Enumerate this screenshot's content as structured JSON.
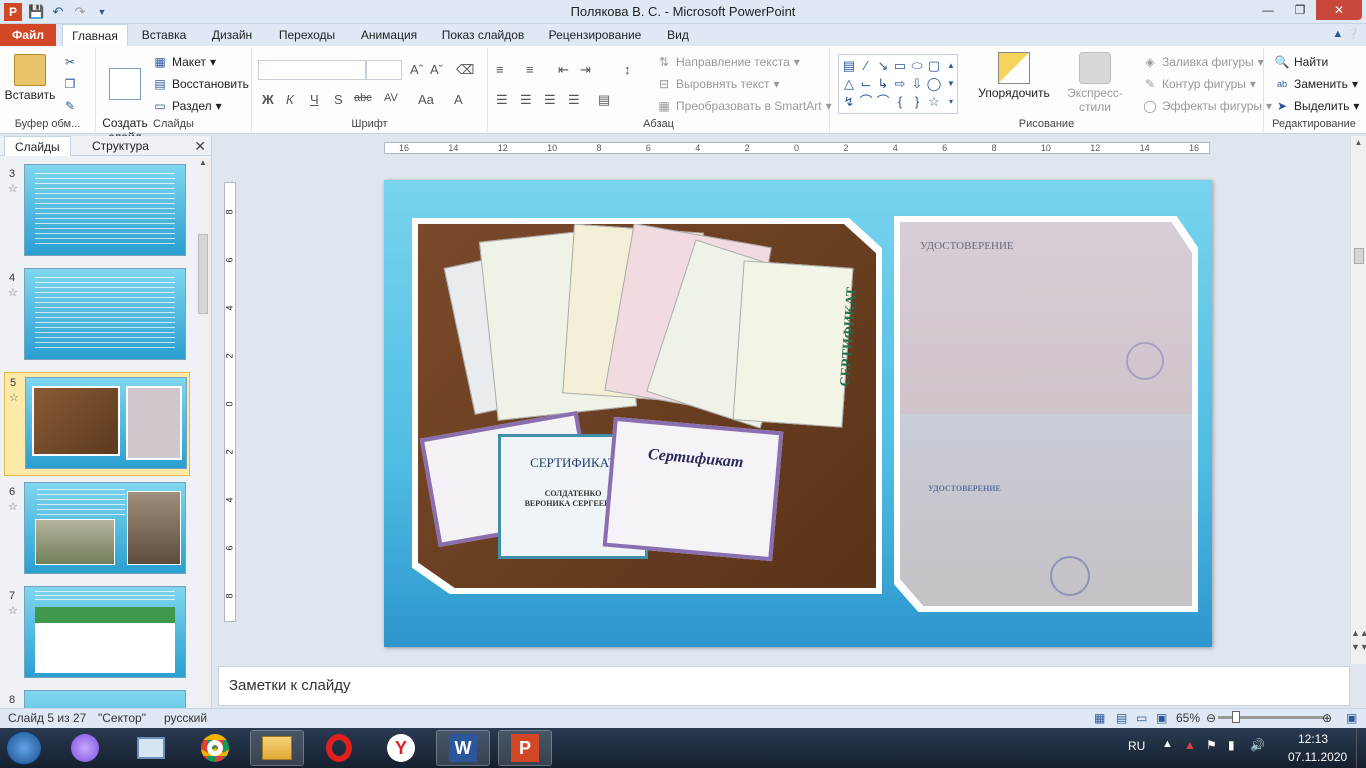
{
  "window": {
    "title": "Полякова В. С.  -  Microsoft PowerPoint",
    "logo": "P"
  },
  "ribbon_tabs": [
    "Файл",
    "Главная",
    "Вставка",
    "Дизайн",
    "Переходы",
    "Анимация",
    "Показ слайдов",
    "Рецензирование",
    "Вид"
  ],
  "ribbon": {
    "clipboard": {
      "paste": "Вставить",
      "label": "Буфер обм..."
    },
    "slides": {
      "new_slide": "Создать\nслайд",
      "layout": "Макет",
      "reset": "Восстановить",
      "section": "Раздел",
      "label": "Слайды"
    },
    "font": {
      "label": "Шрифт",
      "bold": "Ж",
      "italic": "К",
      "underline": "Ч",
      "shadow": "S",
      "strike": "abc",
      "spacing": "AV",
      "case": "Aa",
      "color": "A"
    },
    "paragraph": {
      "text_direction": "Направление текста",
      "align_text": "Выровнять текст",
      "smartart": "Преобразовать в SmartArt",
      "label": "Абзац"
    },
    "drawing": {
      "arrange": "Упорядочить",
      "quick_styles": "Экспресс-стили",
      "fill": "Заливка фигуры",
      "outline": "Контур фигуры",
      "effects": "Эффекты фигуры",
      "label": "Рисование"
    },
    "editing": {
      "find": "Найти",
      "replace": "Заменить",
      "select": "Выделить",
      "label": "Редактирование"
    }
  },
  "panel": {
    "tabs": [
      "Слайды",
      "Структура"
    ],
    "slide_numbers": [
      "3",
      "4",
      "5",
      "6",
      "7",
      "8"
    ],
    "selected": "5"
  },
  "ruler": {
    "h_ticks": [
      "16",
      "14",
      "12",
      "10",
      "8",
      "6",
      "4",
      "2",
      "0",
      "2",
      "4",
      "6",
      "8",
      "10",
      "12",
      "14",
      "16"
    ],
    "v_ticks": [
      "8",
      "6",
      "4",
      "2",
      "0",
      "2",
      "4",
      "6",
      "8"
    ]
  },
  "slide": {
    "cert1_title": "СЕРТИФИКАТ",
    "cert1_name1": "СОЛДАТЕНКО",
    "cert1_name2": "ВЕРОНИКА СЕРГЕЕВНА",
    "cert2_title": "Сертификат",
    "cert3_title": "СЕРТИФИКАТ",
    "doc_title": "УДОСТОВЕРЕНИЕ",
    "doc_title2": "УДОСТОВЕРЕНИЕ"
  },
  "notes": {
    "placeholder": "Заметки к слайду"
  },
  "status": {
    "slide_of": "Слайд 5 из 27",
    "theme": "\"Сектор\"",
    "language": "русский",
    "zoom": "65%",
    "zoom_level": 0.65
  },
  "taskbar": {
    "lang": "RU",
    "time": "12:13",
    "date": "07.11.2020"
  }
}
